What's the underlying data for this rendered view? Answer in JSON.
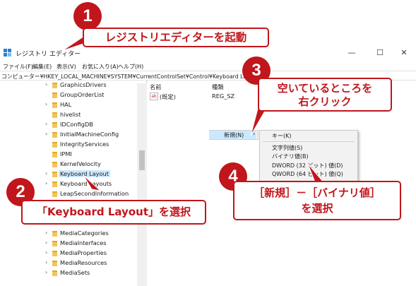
{
  "window": {
    "title": "レジストリ エディター",
    "minimize_glyph": "—",
    "maximize_glyph": "☐",
    "close_glyph": "✕"
  },
  "menu": [
    "ファイル(F)",
    "編集(E)",
    "表示(V)",
    "お気に入り(A)",
    "ヘルプ(H)"
  ],
  "address": "コンピューター¥HKEY_LOCAL_MACHINE¥SYSTEM¥CurrentControlSet¥Control¥Keyboard Layout",
  "tree": {
    "items": [
      {
        "label": "GraphicsDrivers",
        "expander": "›"
      },
      {
        "label": "GroupOrderList",
        "expander": ""
      },
      {
        "label": "HAL",
        "expander": "›"
      },
      {
        "label": "hivelist",
        "expander": ""
      },
      {
        "label": "IDConfigDB",
        "expander": "›"
      },
      {
        "label": "InitialMachineConfig",
        "expander": "›"
      },
      {
        "label": "IntegrityServices",
        "expander": ""
      },
      {
        "label": "IPMI",
        "expander": ""
      },
      {
        "label": "KernelVelocity",
        "expander": ""
      },
      {
        "label": "Keyboard Layout",
        "expander": "›",
        "selected": true
      },
      {
        "label": "Keyboard Layouts",
        "expander": "›"
      },
      {
        "label": "LeapSecondInformation",
        "expander": ""
      },
      {
        "label": "MediaCategories",
        "expander": "›"
      },
      {
        "label": "MediaInterfaces",
        "expander": "›"
      },
      {
        "label": "MediaProperties",
        "expander": "›"
      },
      {
        "label": "MediaResources",
        "expander": "›"
      },
      {
        "label": "MediaSets",
        "expander": "›"
      }
    ]
  },
  "list": {
    "columns": [
      "名前",
      "種類"
    ],
    "rows": [
      {
        "name": "(既定)",
        "type": "REG_SZ",
        "icon": "ab"
      }
    ]
  },
  "context_menu": {
    "new_label": "新規(N)",
    "submenu_arrow": "›",
    "items": [
      "キー(K)",
      "文字列値(S)",
      "バイナリ値(B)",
      "DWORD (32 ビット) 値(D)",
      "QWORD (64 ビット) 値(Q)"
    ]
  },
  "annotations": {
    "step1": {
      "number": "1",
      "text": "レジストリエディターを起動"
    },
    "step2": {
      "number": "2",
      "text": "「Keyboard Layout」を選択"
    },
    "step3": {
      "number": "3",
      "line1": "空いているところを",
      "line2": "右クリック"
    },
    "step4": {
      "number": "4",
      "line1": "［新規］－［バイナリ値］",
      "line2": "を選択"
    }
  },
  "colors": {
    "accent": "#c0161c",
    "selection": "#cce8ff",
    "folder": "#f2c55a"
  }
}
